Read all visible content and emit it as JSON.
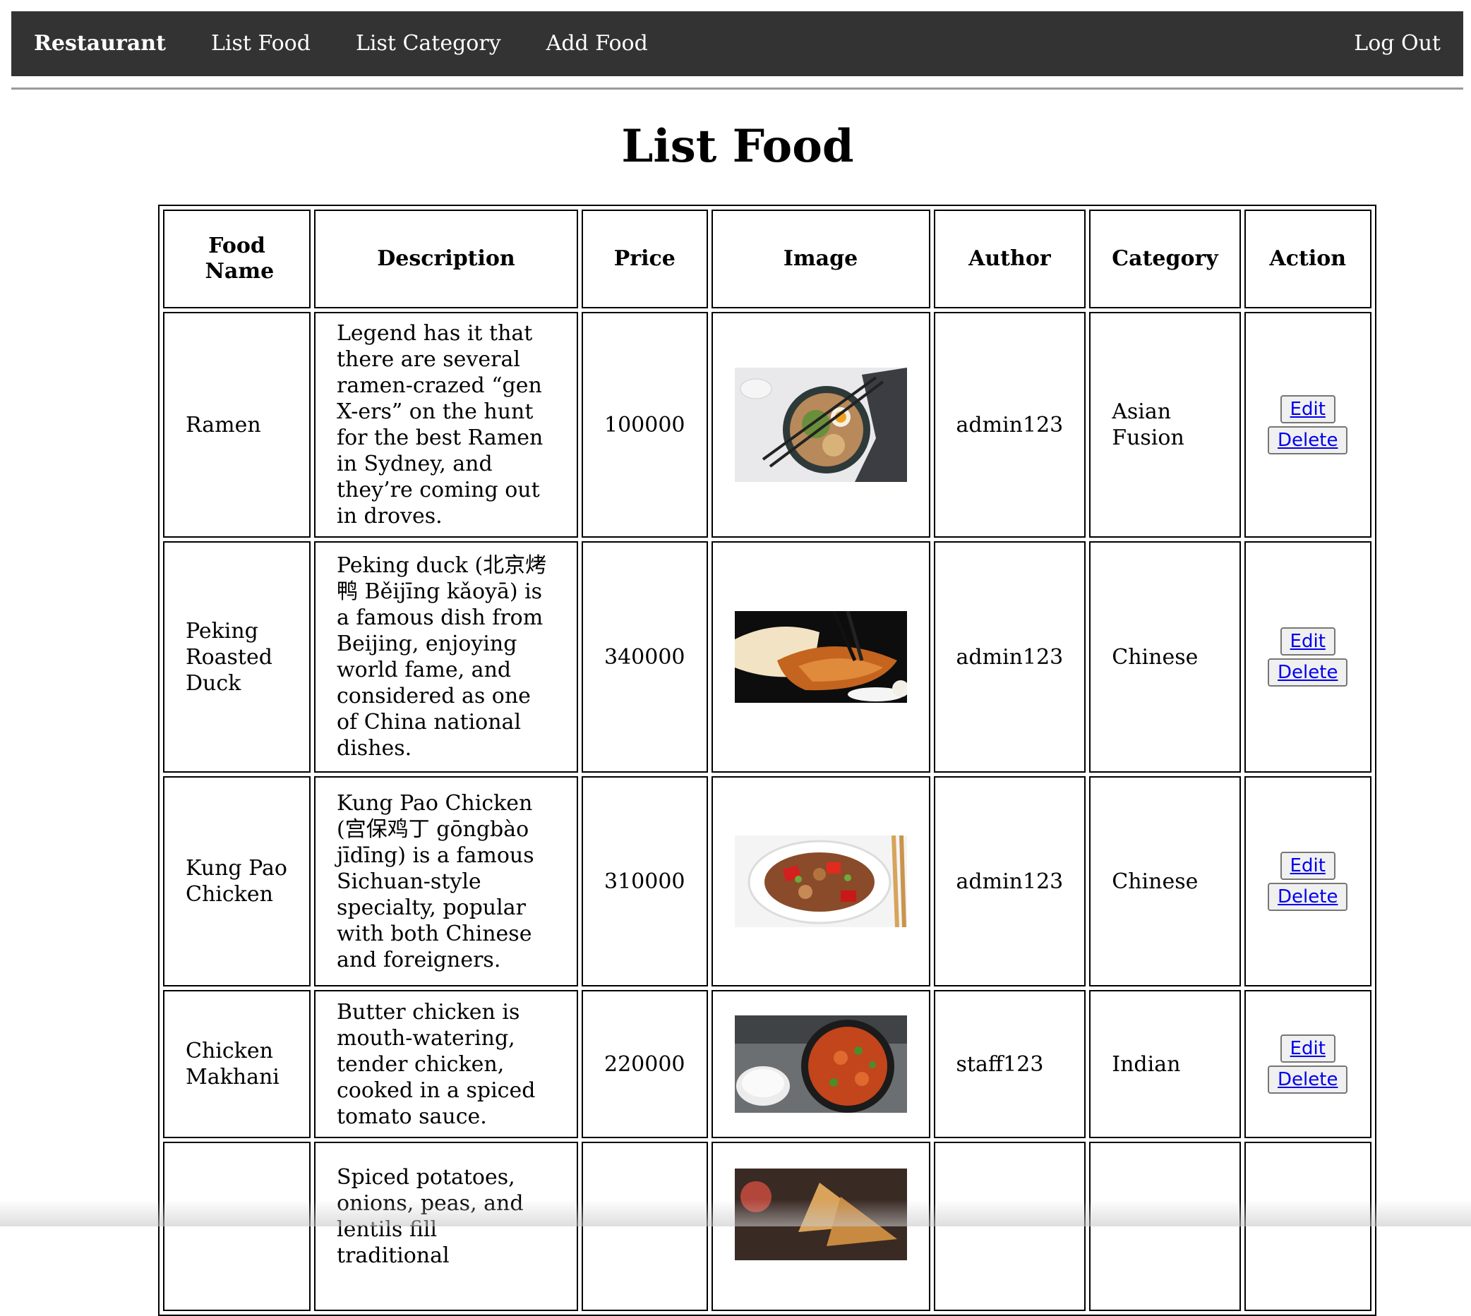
{
  "nav": {
    "brand": "Restaurant",
    "links": [
      "List Food",
      "List Category",
      "Add Food"
    ],
    "logout": "Log Out"
  },
  "page": {
    "title": "List Food"
  },
  "table": {
    "headers": [
      "Food Name",
      "Description",
      "Price",
      "Image",
      "Author",
      "Category",
      "Action"
    ],
    "rows": [
      {
        "name": "Ramen",
        "description": "Legend has it that there are several ramen-crazed “gen X-ers” on the hunt for the best Ramen in Sydney, and they’re coming out in droves.",
        "price": "100000",
        "image": "ramen-photo",
        "author": "admin123",
        "category": "Asian Fusion"
      },
      {
        "name": "Peking Roasted Duck",
        "description": "Peking duck (北京烤鸭 Běijīng kǎoyā) is a famous dish from Beijing, enjoying world fame, and considered as one of China national dishes.",
        "price": "340000",
        "image": "peking-duck-photo",
        "author": "admin123",
        "category": "Chinese"
      },
      {
        "name": "Kung Pao Chicken",
        "description": "Kung Pao Chicken (宫保鸡丁 gōngbào jīdīng) is a famous Sichuan-style specialty, popular with both Chinese and foreigners.",
        "price": "310000",
        "image": "kung-pao-photo",
        "author": "admin123",
        "category": "Chinese"
      },
      {
        "name": "Chicken Makhani",
        "description": "Butter chicken is mouth-watering, tender chicken, cooked in a spiced tomato sauce.",
        "price": "220000",
        "image": "butter-chicken-photo",
        "author": "staff123",
        "category": "Indian"
      },
      {
        "name": "",
        "description": "Spiced potatoes, onions, peas, and lentils fill traditional",
        "price": "",
        "image": "samosa-photo",
        "author": "",
        "category": ""
      }
    ],
    "actions": {
      "edit": "Edit",
      "delete": "Delete"
    }
  }
}
